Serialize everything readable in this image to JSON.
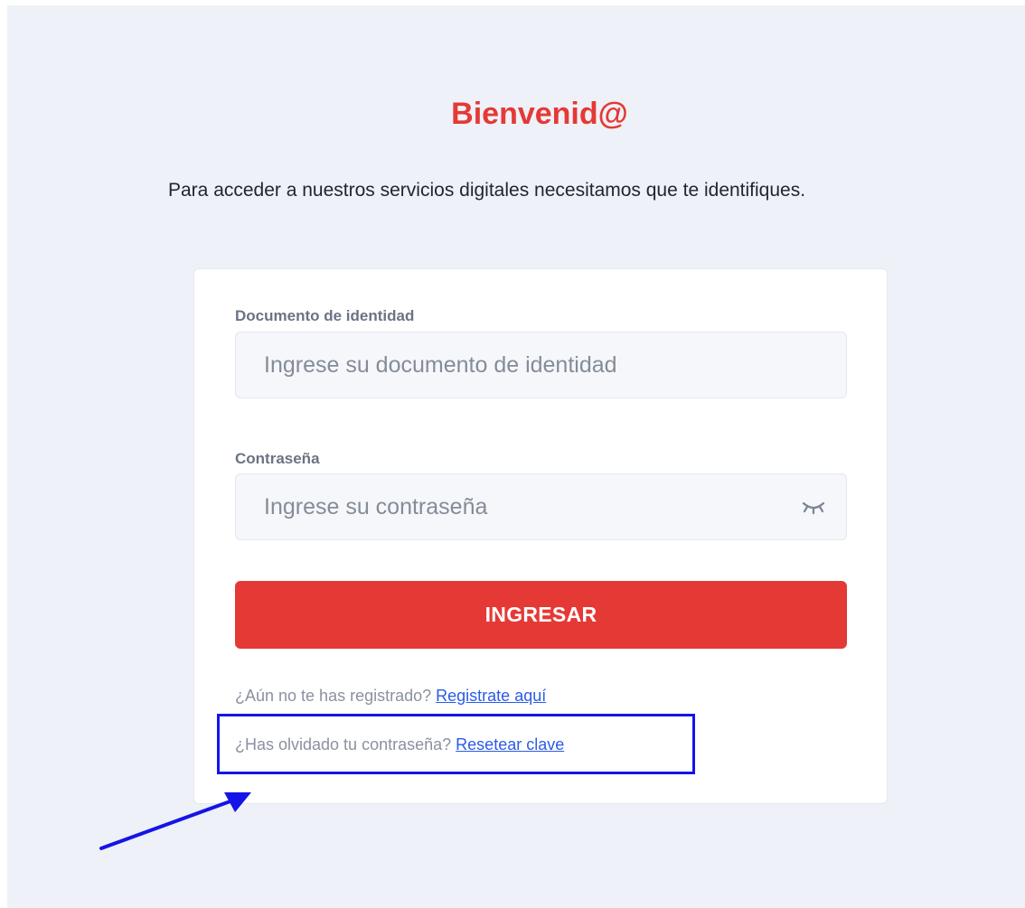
{
  "header": {
    "title": "Bienvenid@",
    "intro": "Para acceder a nuestros servicios digitales necesitamos que te identifiques."
  },
  "form": {
    "document": {
      "label": "Documento de identidad",
      "placeholder": "Ingrese su documento de identidad",
      "value": ""
    },
    "password": {
      "label": "Contraseña",
      "placeholder": "Ingrese su contraseña",
      "value": "",
      "toggle_icon": "eye-closed-icon"
    },
    "submit_label": "INGRESAR"
  },
  "links": {
    "register_prompt": "¿Aún no te has registrado?",
    "register_link": "Registrate aquí",
    "forgot_prompt": "¿Has olvidado tu contraseña?",
    "forgot_link": "Resetear clave"
  },
  "annotation": {
    "highlight_color": "#1414e8",
    "arrow_color": "#1414e8"
  },
  "colors": {
    "accent": "#e53935",
    "link": "#2b5bea",
    "background": "#eef1f7"
  }
}
